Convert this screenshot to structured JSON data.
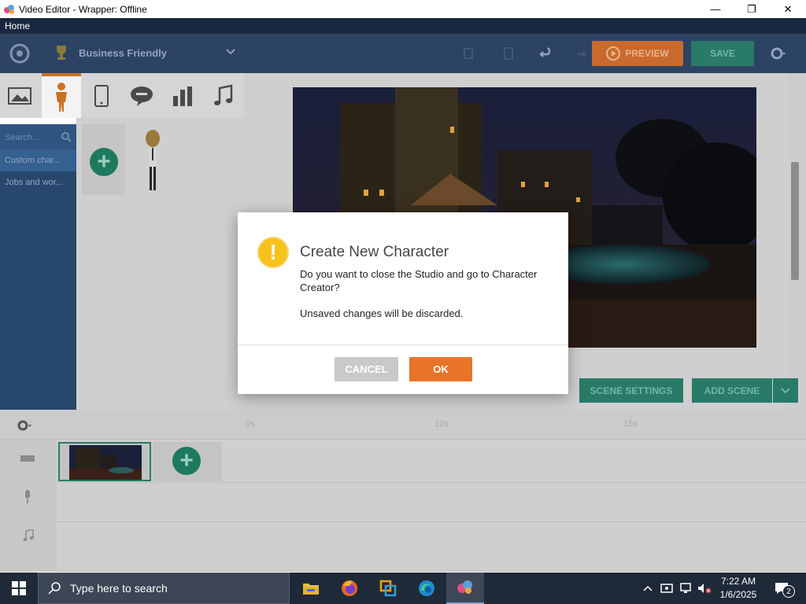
{
  "window": {
    "title": "Video Editor - Wrapper: Offline",
    "minimize_glyph": "—",
    "maximize_glyph": "❐",
    "close_glyph": "✕"
  },
  "menubar": {
    "home": "Home"
  },
  "toolbar": {
    "theme_name": "Business Friendly",
    "preview_label": "PREVIEW",
    "save_label": "SAVE",
    "accent_orange": "#c86a2d",
    "accent_green": "#2a7a68"
  },
  "library": {
    "tabs": [
      "image-icon",
      "character-icon",
      "phone-icon",
      "speech-bubble-icon",
      "chart-icon",
      "music-icon"
    ],
    "search_placeholder": "Search...",
    "categories": [
      "Custom char...",
      "Jobs and wor..."
    ]
  },
  "stage_controls": {
    "scene_settings_label": "SCENE SETTINGS",
    "add_scene_label": "ADD SCENE"
  },
  "timeline": {
    "ticks": [
      "0s",
      "10s",
      "15s"
    ]
  },
  "dialog": {
    "title": "Create New Character",
    "message": "Do you want to close the Studio and go to Character Creator?",
    "note": "Unsaved changes will be discarded.",
    "cancel_label": "CANCEL",
    "ok_label": "OK",
    "warning_glyph": "!"
  },
  "taskbar": {
    "search_placeholder": "Type here to search",
    "time": "7:22 AM",
    "date": "1/6/2025",
    "notification_count": "2"
  }
}
